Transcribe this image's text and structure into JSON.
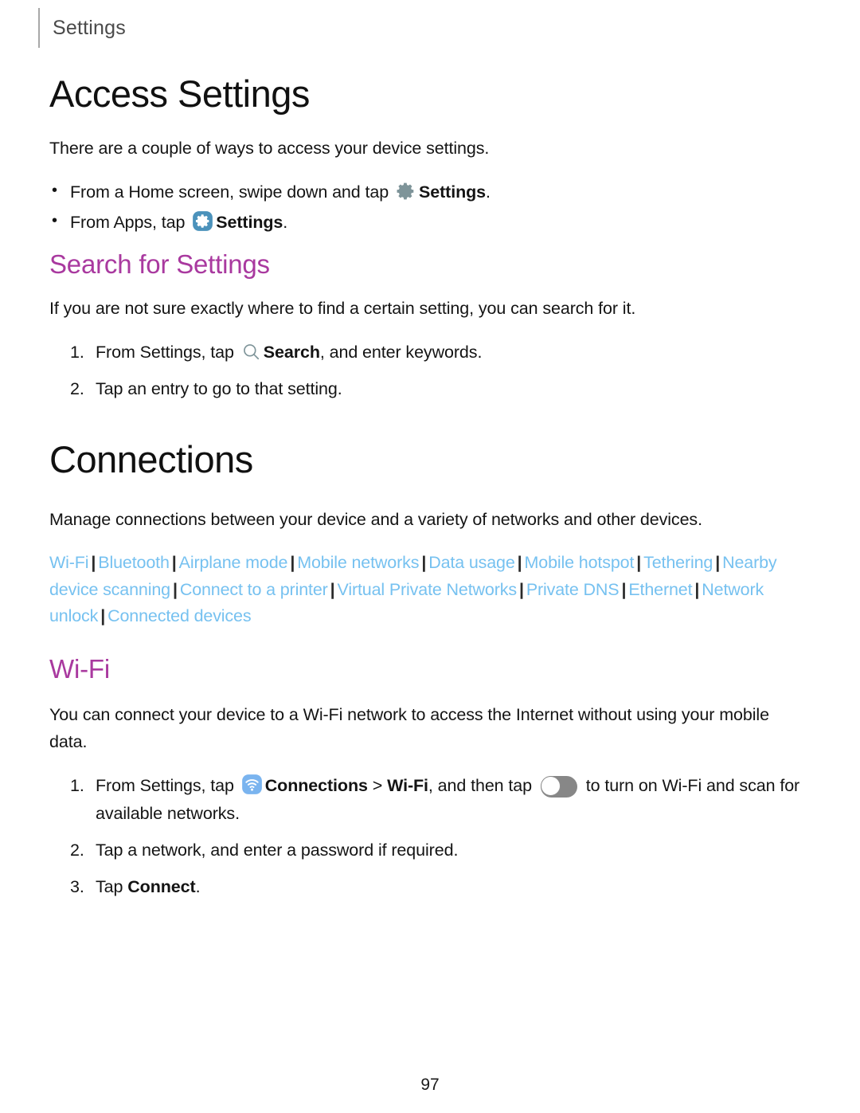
{
  "header": {
    "title": "Settings"
  },
  "access_settings": {
    "title": "Access Settings",
    "intro": "There are a couple of ways to access your device settings.",
    "bullets": [
      {
        "before": "From a Home screen, swipe down and tap",
        "icon": "gear-icon",
        "bold": "Settings",
        "after": "."
      },
      {
        "before": "From Apps, tap",
        "icon": "settings-app-icon",
        "bold": "Settings",
        "after": "."
      }
    ]
  },
  "search_settings": {
    "title": "Search for Settings",
    "intro": "If you are not sure exactly where to find a certain setting, you can search for it.",
    "steps": [
      {
        "before": "From Settings, tap",
        "icon": "search-icon",
        "bold": "Search",
        "after": ", and enter keywords."
      },
      {
        "before": "Tap an entry to go to that setting.",
        "icon": "",
        "bold": "",
        "after": ""
      }
    ]
  },
  "connections": {
    "title": "Connections",
    "intro": "Manage connections between your device and a variety of networks and other devices.",
    "links": [
      "Wi-Fi",
      "Bluetooth",
      "Airplane mode",
      "Mobile networks",
      "Data usage",
      "Mobile hotspot",
      "Tethering",
      "Nearby device scanning",
      "Connect to a printer",
      "Virtual Private Networks",
      "Private DNS",
      "Ethernet",
      "Network unlock",
      "Connected devices"
    ],
    "link_separator": "|"
  },
  "wifi": {
    "title": "Wi-Fi",
    "intro": "You can connect your device to a Wi-Fi network to access the Internet without using your mobile data.",
    "step1": {
      "part1": "From Settings, tap",
      "icon": "connections-icon",
      "bold1": "Connections",
      "part2": ">",
      "bold2": "Wi-Fi",
      "part3": ", and then tap",
      "toggle": "wifi-toggle",
      "part4": "to turn on Wi-Fi and scan for available networks."
    },
    "step2": "Tap a network, and enter a password if required.",
    "step3": {
      "before": "Tap",
      "bold": "Connect",
      "after": "."
    }
  },
  "footer": {
    "page_number": "97"
  },
  "colors": {
    "section_heading": "#a9399f",
    "link": "#76c1f0",
    "gear_gray": "#7e9499",
    "settings_app_blue": "#4b92bb",
    "connections_blue": "#7ab4ef",
    "toggle_track": "#878787"
  }
}
